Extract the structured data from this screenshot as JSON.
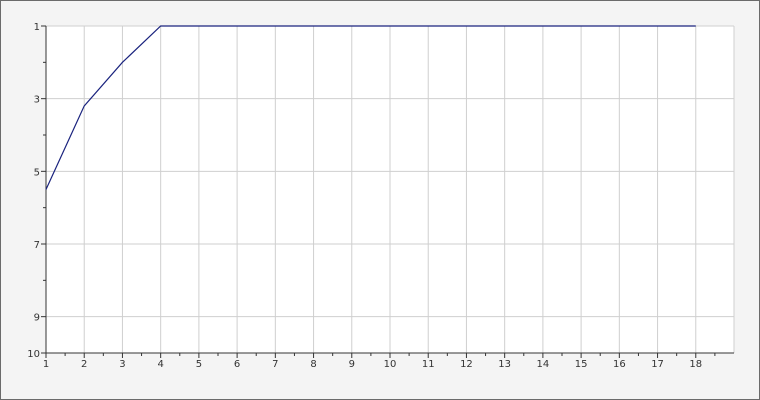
{
  "chart_data": {
    "type": "line",
    "title": "",
    "xlabel": "",
    "ylabel": "",
    "x_ticks": [
      "1",
      "2",
      "3",
      "4",
      "5",
      "6",
      "7",
      "8",
      "9",
      "10",
      "11",
      "12",
      "13",
      "14",
      "15",
      "16",
      "17",
      "18"
    ],
    "y_ticks": [
      "1",
      "3",
      "5",
      "7",
      "9",
      "10"
    ],
    "xlim": [
      1,
      19
    ],
    "ylim": [
      10,
      1
    ],
    "y_inverted": true,
    "grid": true,
    "legend": "none",
    "series": [
      {
        "color": "#1a237e",
        "x": [
          1,
          2,
          3,
          4,
          5,
          6,
          7,
          8,
          9,
          10,
          11,
          12,
          13,
          14,
          15,
          16,
          17,
          18
        ],
        "y": [
          5.5,
          3.2,
          2.0,
          1,
          1,
          1,
          1,
          1,
          1,
          1,
          1,
          1,
          1,
          1,
          1,
          1,
          1,
          1
        ]
      }
    ]
  },
  "colors": {
    "background": "#f4f4f4",
    "plot_background": "#ffffff",
    "grid": "#cfcfcf",
    "axis": "#333333",
    "line": "#1a237e"
  }
}
